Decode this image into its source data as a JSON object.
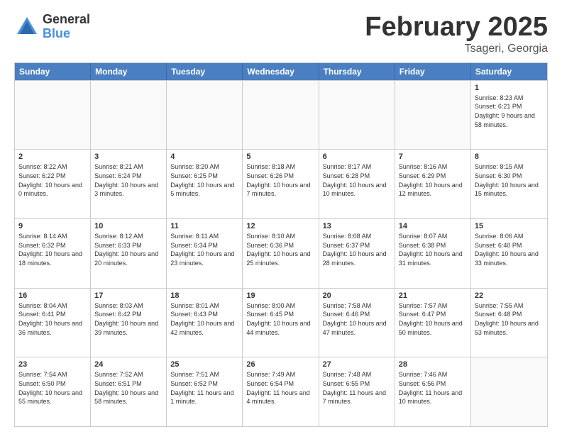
{
  "logo": {
    "general": "General",
    "blue": "Blue"
  },
  "title": {
    "month": "February 2025",
    "location": "Tsageri, Georgia"
  },
  "header_days": [
    "Sunday",
    "Monday",
    "Tuesday",
    "Wednesday",
    "Thursday",
    "Friday",
    "Saturday"
  ],
  "weeks": [
    [
      {
        "day": "",
        "info": "",
        "empty": true
      },
      {
        "day": "",
        "info": "",
        "empty": true
      },
      {
        "day": "",
        "info": "",
        "empty": true
      },
      {
        "day": "",
        "info": "",
        "empty": true
      },
      {
        "day": "",
        "info": "",
        "empty": true
      },
      {
        "day": "",
        "info": "",
        "empty": true
      },
      {
        "day": "1",
        "info": "Sunrise: 8:23 AM\nSunset: 6:21 PM\nDaylight: 9 hours and 58 minutes.",
        "empty": false
      }
    ],
    [
      {
        "day": "2",
        "info": "Sunrise: 8:22 AM\nSunset: 6:22 PM\nDaylight: 10 hours and 0 minutes.",
        "empty": false
      },
      {
        "day": "3",
        "info": "Sunrise: 8:21 AM\nSunset: 6:24 PM\nDaylight: 10 hours and 3 minutes.",
        "empty": false
      },
      {
        "day": "4",
        "info": "Sunrise: 8:20 AM\nSunset: 6:25 PM\nDaylight: 10 hours and 5 minutes.",
        "empty": false
      },
      {
        "day": "5",
        "info": "Sunrise: 8:18 AM\nSunset: 6:26 PM\nDaylight: 10 hours and 7 minutes.",
        "empty": false
      },
      {
        "day": "6",
        "info": "Sunrise: 8:17 AM\nSunset: 6:28 PM\nDaylight: 10 hours and 10 minutes.",
        "empty": false
      },
      {
        "day": "7",
        "info": "Sunrise: 8:16 AM\nSunset: 6:29 PM\nDaylight: 10 hours and 12 minutes.",
        "empty": false
      },
      {
        "day": "8",
        "info": "Sunrise: 8:15 AM\nSunset: 6:30 PM\nDaylight: 10 hours and 15 minutes.",
        "empty": false
      }
    ],
    [
      {
        "day": "9",
        "info": "Sunrise: 8:14 AM\nSunset: 6:32 PM\nDaylight: 10 hours and 18 minutes.",
        "empty": false
      },
      {
        "day": "10",
        "info": "Sunrise: 8:12 AM\nSunset: 6:33 PM\nDaylight: 10 hours and 20 minutes.",
        "empty": false
      },
      {
        "day": "11",
        "info": "Sunrise: 8:11 AM\nSunset: 6:34 PM\nDaylight: 10 hours and 23 minutes.",
        "empty": false
      },
      {
        "day": "12",
        "info": "Sunrise: 8:10 AM\nSunset: 6:36 PM\nDaylight: 10 hours and 25 minutes.",
        "empty": false
      },
      {
        "day": "13",
        "info": "Sunrise: 8:08 AM\nSunset: 6:37 PM\nDaylight: 10 hours and 28 minutes.",
        "empty": false
      },
      {
        "day": "14",
        "info": "Sunrise: 8:07 AM\nSunset: 6:38 PM\nDaylight: 10 hours and 31 minutes.",
        "empty": false
      },
      {
        "day": "15",
        "info": "Sunrise: 8:06 AM\nSunset: 6:40 PM\nDaylight: 10 hours and 33 minutes.",
        "empty": false
      }
    ],
    [
      {
        "day": "16",
        "info": "Sunrise: 8:04 AM\nSunset: 6:41 PM\nDaylight: 10 hours and 36 minutes.",
        "empty": false
      },
      {
        "day": "17",
        "info": "Sunrise: 8:03 AM\nSunset: 6:42 PM\nDaylight: 10 hours and 39 minutes.",
        "empty": false
      },
      {
        "day": "18",
        "info": "Sunrise: 8:01 AM\nSunset: 6:43 PM\nDaylight: 10 hours and 42 minutes.",
        "empty": false
      },
      {
        "day": "19",
        "info": "Sunrise: 8:00 AM\nSunset: 6:45 PM\nDaylight: 10 hours and 44 minutes.",
        "empty": false
      },
      {
        "day": "20",
        "info": "Sunrise: 7:58 AM\nSunset: 6:46 PM\nDaylight: 10 hours and 47 minutes.",
        "empty": false
      },
      {
        "day": "21",
        "info": "Sunrise: 7:57 AM\nSunset: 6:47 PM\nDaylight: 10 hours and 50 minutes.",
        "empty": false
      },
      {
        "day": "22",
        "info": "Sunrise: 7:55 AM\nSunset: 6:48 PM\nDaylight: 10 hours and 53 minutes.",
        "empty": false
      }
    ],
    [
      {
        "day": "23",
        "info": "Sunrise: 7:54 AM\nSunset: 6:50 PM\nDaylight: 10 hours and 55 minutes.",
        "empty": false
      },
      {
        "day": "24",
        "info": "Sunrise: 7:52 AM\nSunset: 6:51 PM\nDaylight: 10 hours and 58 minutes.",
        "empty": false
      },
      {
        "day": "25",
        "info": "Sunrise: 7:51 AM\nSunset: 6:52 PM\nDaylight: 11 hours and 1 minute.",
        "empty": false
      },
      {
        "day": "26",
        "info": "Sunrise: 7:49 AM\nSunset: 6:54 PM\nDaylight: 11 hours and 4 minutes.",
        "empty": false
      },
      {
        "day": "27",
        "info": "Sunrise: 7:48 AM\nSunset: 6:55 PM\nDaylight: 11 hours and 7 minutes.",
        "empty": false
      },
      {
        "day": "28",
        "info": "Sunrise: 7:46 AM\nSunset: 6:56 PM\nDaylight: 11 hours and 10 minutes.",
        "empty": false
      },
      {
        "day": "",
        "info": "",
        "empty": true
      }
    ]
  ]
}
